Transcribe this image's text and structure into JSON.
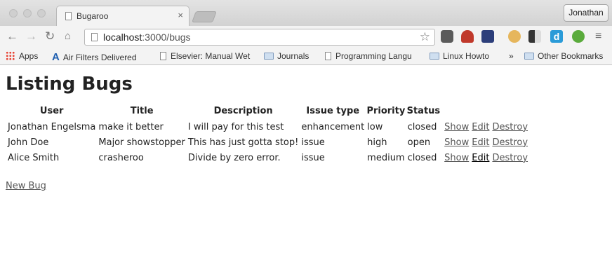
{
  "window": {
    "tab_title": "Bugaroo",
    "profile_name": "Jonathan"
  },
  "toolbar": {
    "url_host": "localhost",
    "url_path": ":3000/bugs"
  },
  "bookmarks": {
    "apps": "Apps",
    "items": [
      "Air Filters Delivered",
      "Elsevier: Manual Wet",
      "Journals",
      "Programming Langu",
      "Linux Howto"
    ],
    "overflow": "»",
    "other": "Other Bookmarks"
  },
  "page": {
    "heading": "Listing Bugs",
    "columns": [
      "User",
      "Title",
      "Description",
      "Issue type",
      "Priority",
      "Status"
    ],
    "rows": [
      {
        "user": "Jonathan Engelsma",
        "title": "make it better",
        "description": "I will pay for this test",
        "issue_type": "enhancement",
        "priority": "low",
        "status": "closed"
      },
      {
        "user": "John Doe",
        "title": "Major showstopper",
        "description": "This has just gotta stop!",
        "issue_type": "issue",
        "priority": "high",
        "status": "open"
      },
      {
        "user": "Alice Smith",
        "title": "crasheroo",
        "description": "Divide by zero error.",
        "issue_type": "issue",
        "priority": "medium",
        "status": "closed"
      }
    ],
    "actions": {
      "show": "Show",
      "edit": "Edit",
      "destroy": "Destroy"
    },
    "new_link": "New Bug"
  }
}
